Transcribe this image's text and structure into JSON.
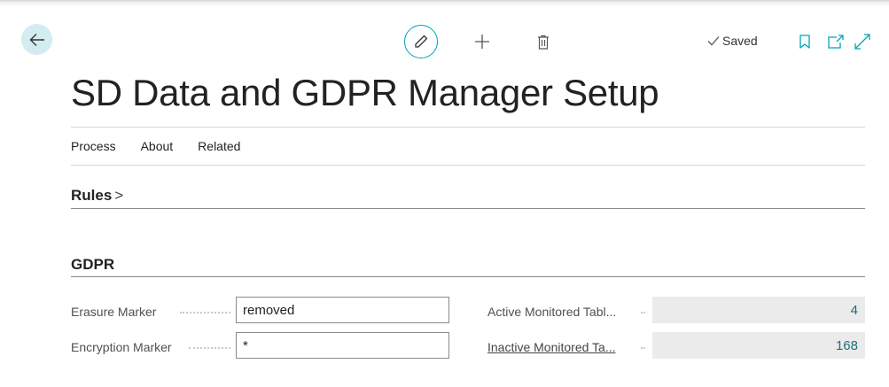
{
  "page": {
    "title": "SD Data and GDPR Manager Setup"
  },
  "toolbar": {
    "status": "Saved"
  },
  "icons": {
    "back": "arrow-left-icon",
    "edit": "pencil-icon",
    "add": "plus-icon",
    "delete": "trash-icon",
    "saved": "check-icon",
    "bookmark": "bookmark-icon",
    "open_new": "open-new-window-icon",
    "expand": "expand-icon"
  },
  "menu": {
    "items": [
      "Process",
      "About",
      "Related"
    ]
  },
  "rules": {
    "title": "Rules",
    "chevron": ">"
  },
  "gdpr": {
    "title": "GDPR",
    "erasure_label": "Erasure Marker",
    "erasure_value": "removed",
    "encryption_label": "Encryption Marker",
    "encryption_value": "*",
    "active_label": "Active Monitored Tabl...",
    "active_value": "4",
    "inactive_label": "Inactive Monitored Ta...",
    "inactive_value": "168"
  },
  "colors": {
    "accent": "#00a4b8",
    "back_bg": "#d3ecef",
    "value": "#1d6e78",
    "readonly_bg": "#ebebeb"
  }
}
